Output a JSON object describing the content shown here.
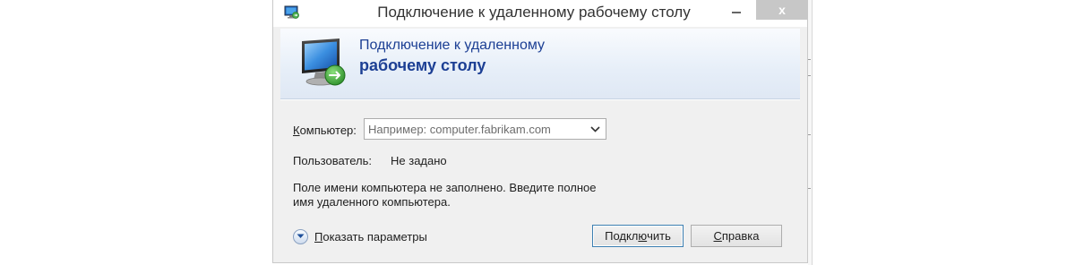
{
  "window": {
    "title": "Подключение к удаленному рабочему столу",
    "close_glyph": "x"
  },
  "banner": {
    "line1": "Подключение к удаленному",
    "line2": "рабочему столу"
  },
  "form": {
    "computer_label_accel": "К",
    "computer_label_rest": "омпьютер:",
    "computer_placeholder": "Например: computer.fabrikam.com",
    "computer_value": "",
    "user_label": "Пользователь:",
    "user_value": "Не задано",
    "hint_line1": "Поле имени компьютера не заполнено. Введите полное",
    "hint_line2": "имя удаленного компьютера."
  },
  "options": {
    "show_label_accel": "П",
    "show_label_rest": "оказать параметры"
  },
  "buttons": {
    "connect_pre": "Подкл",
    "connect_accel": "ю",
    "connect_post": "чить",
    "help_accel": "С",
    "help_rest": "правка"
  },
  "icons": {
    "app": "remote-desktop-icon",
    "banner": "remote-desktop-monitor-icon",
    "expand": "chevron-down-circle-icon",
    "combo": "chevron-down-icon"
  },
  "colors": {
    "banner_text": "#1c3f94",
    "close_button": "#c7c7c7",
    "default_button_border": "#3c7fb1"
  }
}
